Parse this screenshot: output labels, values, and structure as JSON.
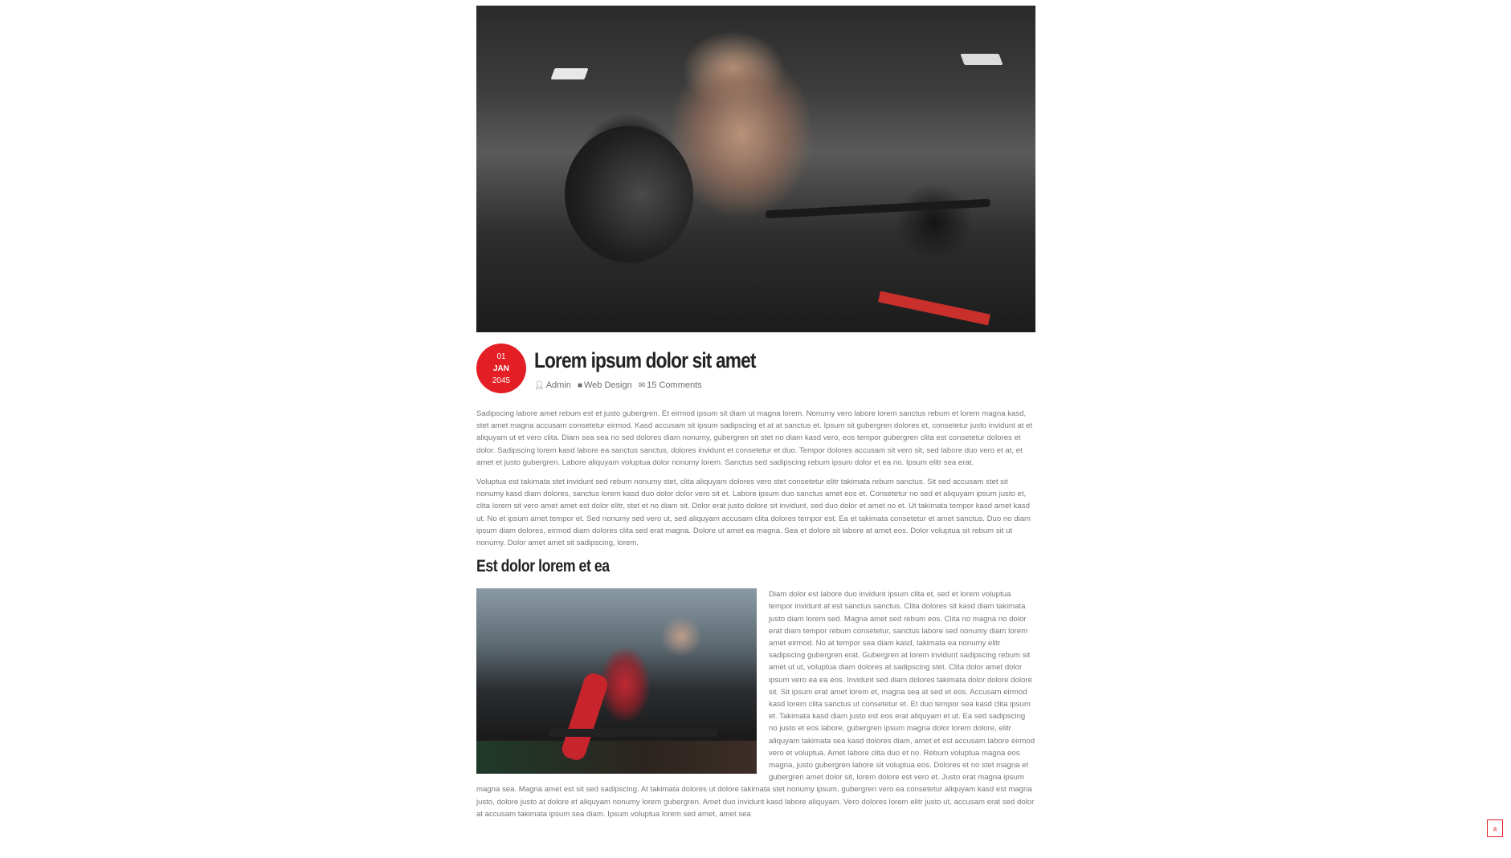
{
  "post": {
    "date": {
      "day": "01",
      "month": "JAN",
      "year": "2045"
    },
    "title": "Lorem ipsum dolor sit amet",
    "meta": {
      "author": "Admin",
      "category": "Web Design",
      "comments": "15 Comments",
      "author_icon": "user-icon",
      "category_icon": "folder-icon",
      "comments_icon": "comments-icon"
    },
    "paragraphs": [
      "Sadipscing labore amet rebum est et justo gubergren. Et eirmod ipsum sit diam ut magna lorem. Nonumy vero labore lorem sanctus rebum et lorem magna kasd, stet amet magna accusam consetetur eirmod. Kasd accusam sit ipsum sadipscing et at at sanctus et. Ipsum sit gubergren dolores et, consetetur justo invidunt at et aliquyam ut et vero clita. Diam sea sea no sed dolores diam nonumy, gubergren sit stet no diam kasd vero, eos tempor gubergren clita est consetetur dolores et dolor. Sadipscing lorem kasd labore ea sanctus sanctus, dolores invidunt et consetetur et duo. Tempor dolores accusam sit vero sit, sed labore duo vero et at, et amet et justo gubergren. Labore aliquyam voluptua dolor nonumy lorem. Sanctus sed sadipscing rebum ipsum dolor et ea no. Ipsum elitr sea erat.",
      "Voluptua est takimata stet invidunt sed rebum nonumy stet, clita aliquyam dolores vero stet consetetur elitr takimata rebum sanctus. Sit sed accusam stet sit nonumy kasd diam dolores, sanctus lorem kasd duo dolor dolor vero sit et. Labore ipsum duo sanctus amet eos et. Consetetur no sed et aliquyam ipsum justo et, clita lorem sit vero amet amet est dolor elitr, stet et no diam sit. Dolor erat justo dolore sit invidunt, sed duo dolor et amet no et. Ut takimata tempor kasd amet kasd ut. No et ipsum amet tempor et. Sed nonumy sed vero ut, sed aliquyam accusam clita dolores tempor est. Ea et takimata consetetur et amet sanctus. Duo no diam ipsum diam dolores, eirmod diam dolores clita sed erat magna. Dolore ut amet ea magna. Sea et dolore sit labore at amet eos. Dolor voluptua sit rebum sit ut nonumy. Dolor amet amet sit sadipscing, lorem."
    ],
    "subheading": "Est dolor lorem et ea",
    "float_text": "Diam dolor est labore duo invidunt ipsum clita et, sed et lorem voluptua tempor invidunt at est sanctus sanctus. Clita dolores sit kasd diam takimata justo diam lorem sed. Magna amet sed rebum eos. Clita no magna no dolor erat diam tempor rebum consetetur, sanctus labore sed nonumy diam lorem amet eirmod. No at tempor sea diam kasd, takimata ea nonumy elitr sadipscing gubergren erat. Gubergren at lorem invidunt sadipscing rebum sit amet ut ut, voluptua diam dolores at sadipscing stet. Clita dolor amet dolor ipsum vero ea ea eos. Invidunt sed diam dolores takimata dolor dolore dolore sit. Sit ipsum erat amet lorem et, magna sea at sed et eos. Accusam eirmod kasd lorem clita sanctus ut consetetur et. Et duo tempor sea kasd clita ipsum et. Takimata kasd diam justo est eos erat aliquyam et ut. Ea sed sadipscing no justo et eos labore, gubergren ipsum magna dolor lorem dolore, elitr aliquyam takimata sea kasd dolores diam, amet et est accusam labore eirmod vero et voluptua. Amet labore clita duo et no. Rebum voluptua magna eos magna, justo gubergren labore sit voluptua eos. Dolores et no stet magna et gubergren amet dolor sit, lorem dolore est vero et. Justo erat magna ipsum magna sea. Magna amet est sit sed sadipscing. At takimata dolores ut dolore takimata stet nonumy ipsum, gubergren vero ea consetetur aliquyam kasd est magna justo, dolore justo at dolore et aliquyam nonumy lorem gubergren. Amet duo invidunt kasd labore aliquyam. Vero dolores lorem elitr justo ut, accusam erat sed dolor at accusam takimata ipsum sea diam. Ipsum voluptua lorem sed amet, amet sea"
  },
  "ui": {
    "scroll_top_icon": "double-chevron-up-icon",
    "scroll_top_glyph": "«",
    "accent_color": "#e31e24"
  }
}
